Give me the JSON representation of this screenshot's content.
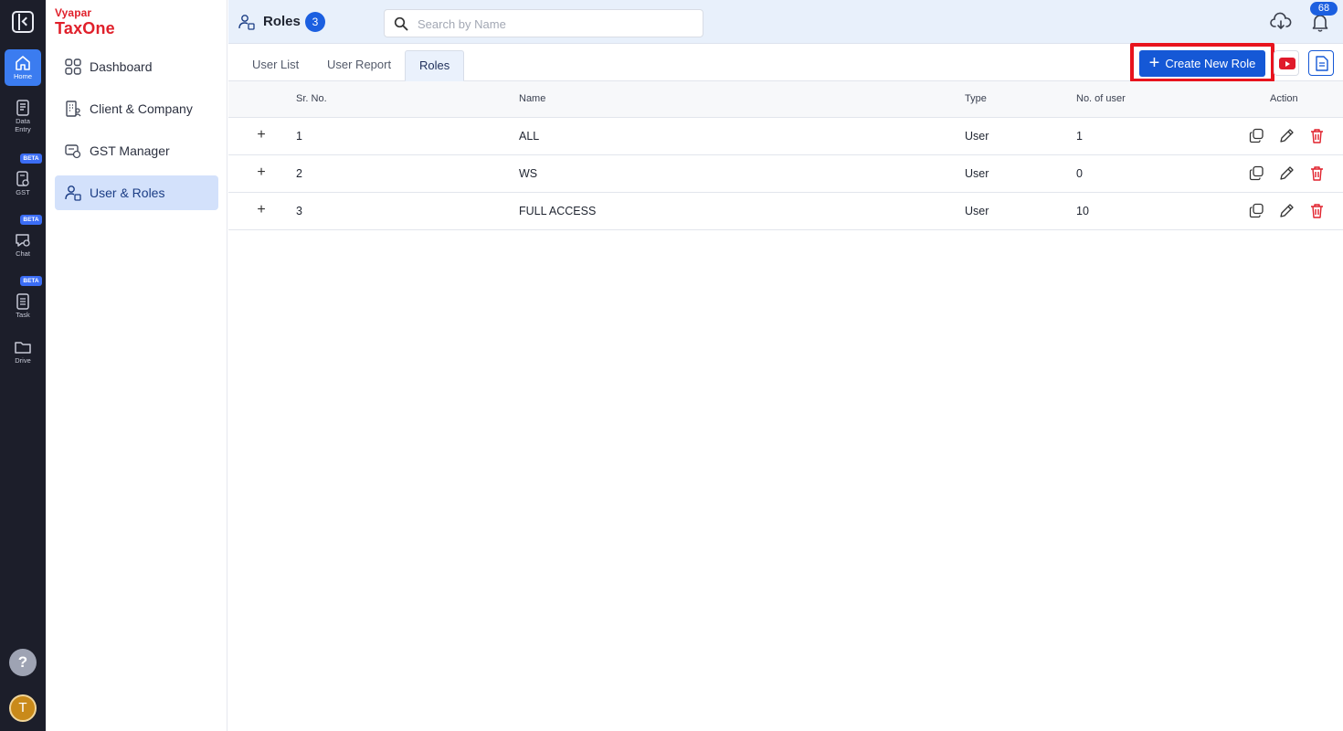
{
  "rail": {
    "items": [
      {
        "label": "Home",
        "icon": "home-icon"
      },
      {
        "label": "Data",
        "label2": "Entry",
        "icon": "data-entry-icon"
      },
      {
        "label": "GST",
        "icon": "gst-icon",
        "badge": "BETA"
      },
      {
        "label": "Chat",
        "icon": "chat-icon",
        "badge": "BETA"
      },
      {
        "label": "Task",
        "icon": "task-icon",
        "badge": "BETA"
      },
      {
        "label": "Drive",
        "icon": "drive-icon"
      }
    ],
    "help": "?",
    "avatar_initial": "T"
  },
  "brand": {
    "top": "Vyapar",
    "main": "TaxOne",
    "color": "#e0202b"
  },
  "sidebar": {
    "items": [
      {
        "label": "Dashboard",
        "icon": "dashboard-icon"
      },
      {
        "label": "Client & Company",
        "icon": "client-company-icon"
      },
      {
        "label": "GST Manager",
        "icon": "gst-manager-icon"
      },
      {
        "label": "User & Roles",
        "icon": "user-roles-icon",
        "active": true
      }
    ]
  },
  "header": {
    "title": "Roles",
    "count": "3",
    "search_placeholder": "Search by Name",
    "notification_count": "68"
  },
  "tabs": [
    {
      "label": "User List"
    },
    {
      "label": "User Report"
    },
    {
      "label": "Roles",
      "active": true
    }
  ],
  "actions": {
    "create_label": "Create New Role",
    "accent": "#1558d6",
    "highlight": "#e8141e"
  },
  "table": {
    "columns": [
      "Sr. No.",
      "Name",
      "Type",
      "No. of user",
      "Action"
    ],
    "rows": [
      {
        "sr": "1",
        "name": "ALL",
        "type": "User",
        "users": "1"
      },
      {
        "sr": "2",
        "name": "WS",
        "type": "User",
        "users": "0"
      },
      {
        "sr": "3",
        "name": "FULL ACCESS",
        "type": "User",
        "users": "10"
      }
    ]
  }
}
